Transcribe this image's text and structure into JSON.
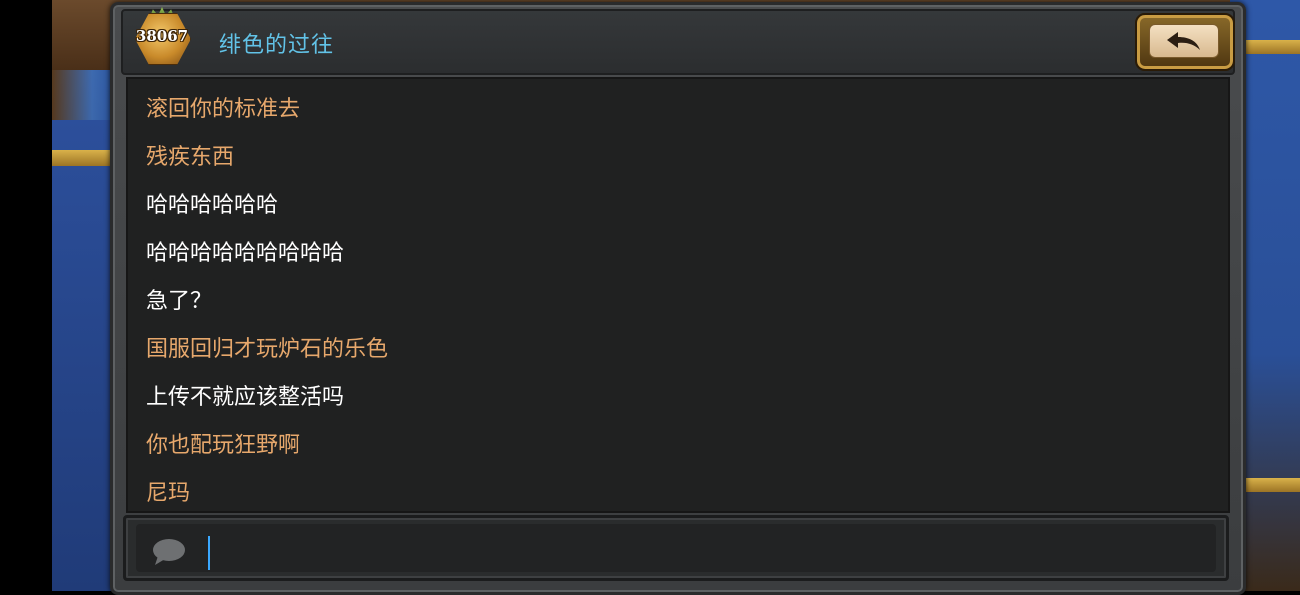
{
  "header": {
    "rank_number": "38067",
    "friend_name": "绯色的过往"
  },
  "messages": [
    {
      "text": "滚回你的标准去",
      "sender": "them"
    },
    {
      "text": "残疾东西",
      "sender": "them"
    },
    {
      "text": "哈哈哈哈哈哈",
      "sender": "me"
    },
    {
      "text": "哈哈哈哈哈哈哈哈哈",
      "sender": "me"
    },
    {
      "text": "急了？",
      "sender": "me"
    },
    {
      "text": "国服回归才玩炉石的乐色",
      "sender": "them"
    },
    {
      "text": "上传不就应该整活吗",
      "sender": "me"
    },
    {
      "text": "你也配玩狂野啊",
      "sender": "them"
    },
    {
      "text": "尼玛",
      "sender": "them"
    }
  ],
  "input": {
    "value": ""
  },
  "icons": {
    "back": "back-arrow-icon",
    "chat": "chat-bubble-icon",
    "rank": "rank-gem-icon"
  },
  "colors": {
    "them_text": "#e7a86c",
    "me_text": "#ffffff",
    "friend_name": "#62c3e8",
    "caret": "#3aa8ff"
  }
}
